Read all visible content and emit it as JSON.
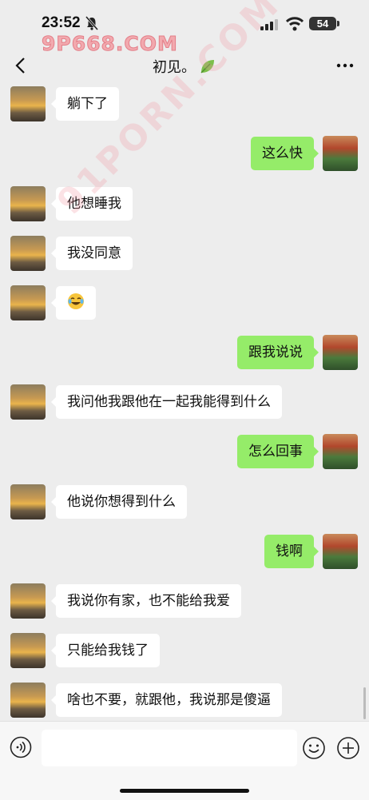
{
  "status_bar": {
    "time": "23:52",
    "battery": "54"
  },
  "watermarks": {
    "top": "9P668.COM",
    "diagonal": "91PORN.COM"
  },
  "chat": {
    "title": "初见。"
  },
  "messages": [
    {
      "side": "left",
      "text": "躺下了"
    },
    {
      "side": "right",
      "text": "这么快"
    },
    {
      "side": "left",
      "text": "他想睡我"
    },
    {
      "side": "left",
      "text": "我没同意"
    },
    {
      "side": "left",
      "text": "",
      "emoji": "laughing-tears-emoji"
    },
    {
      "side": "right",
      "text": "跟我说说"
    },
    {
      "side": "left",
      "text": "我问他我跟他在一起我能得到什么"
    },
    {
      "side": "right",
      "text": "怎么回事"
    },
    {
      "side": "left",
      "text": "他说你想得到什么"
    },
    {
      "side": "right",
      "text": "钱啊"
    },
    {
      "side": "left",
      "text": "我说你有家，也不能给我爱"
    },
    {
      "side": "left",
      "text": "只能给我钱了"
    },
    {
      "side": "left",
      "text": "啥也不要，就跟他，我说那是傻逼"
    }
  ],
  "input": {
    "value": ""
  },
  "colors": {
    "sent_bubble": "#95ec69",
    "received_bubble": "#ffffff",
    "background": "#ededed"
  }
}
